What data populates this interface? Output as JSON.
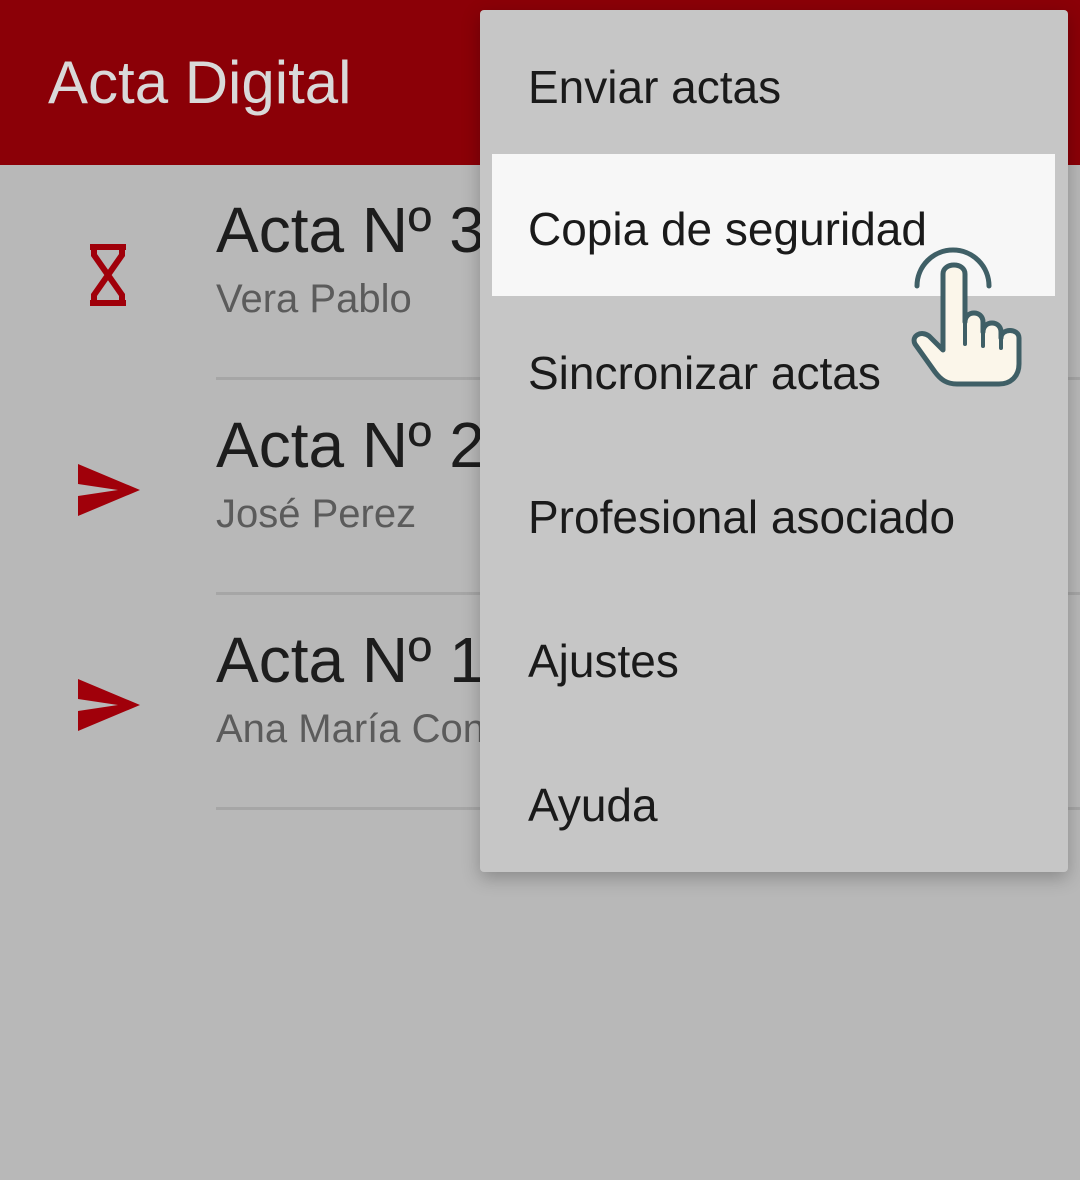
{
  "app": {
    "title": "Acta Digital"
  },
  "actas": [
    {
      "title": "Acta Nº 3",
      "name": "Vera Pablo",
      "status_icon": "hourglass-icon"
    },
    {
      "title": "Acta Nº 2",
      "name": "José Perez",
      "status_icon": "send-icon"
    },
    {
      "title": "Acta Nº 1",
      "name": "Ana María Con",
      "status_icon": "send-icon"
    }
  ],
  "menu": {
    "items": [
      {
        "label": "Enviar actas"
      },
      {
        "label": "Copia de seguridad",
        "selected": true
      },
      {
        "label": "Sincronizar actas"
      },
      {
        "label": "Profesional asociado"
      },
      {
        "label": "Ajustes"
      },
      {
        "label": "Ayuda"
      }
    ]
  },
  "colors": {
    "brand": "#8b0007",
    "icon": "#a0000a",
    "scrim_background": "#b8b8b8",
    "menu_background": "#c6c6c6",
    "selected_item": "#f7f7f7"
  },
  "pointer": {
    "icon": "hand-pointer-icon"
  }
}
